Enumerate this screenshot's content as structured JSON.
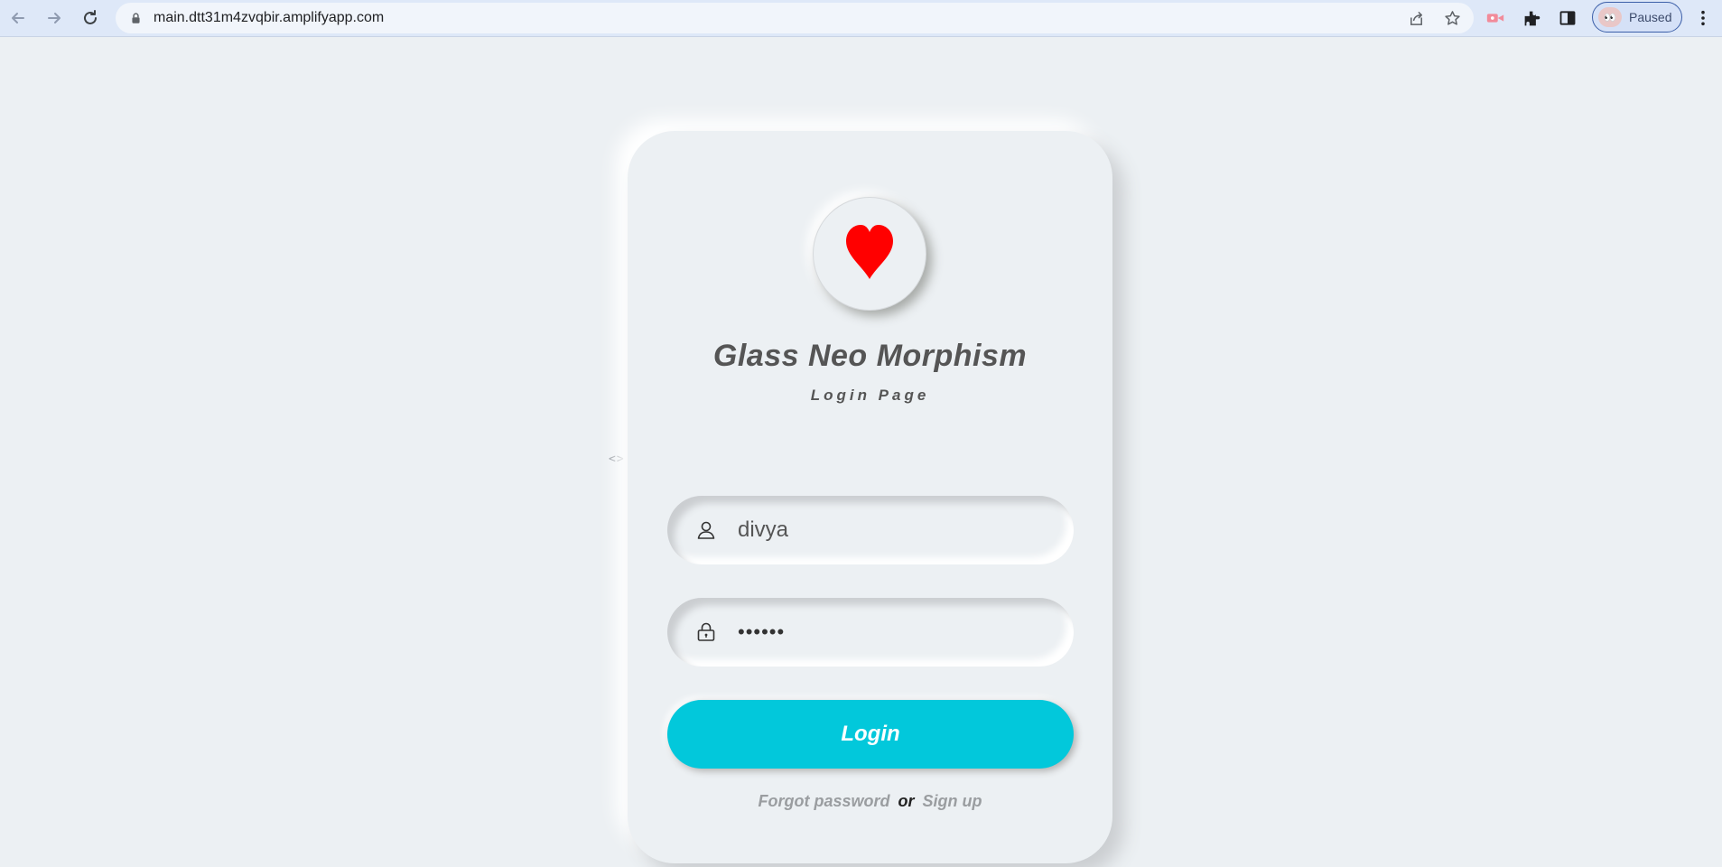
{
  "browser": {
    "url": "main.dtt31m4zvqbir.amplifyapp.com",
    "profile_status": "Paused"
  },
  "page": {
    "side_toggle": "<>",
    "logo_icon": "heart-icon",
    "title": "Glass Neo Morphism",
    "subtitle": "Login Page",
    "username": {
      "value": "divya",
      "icon": "user-icon"
    },
    "password": {
      "value": "••••••",
      "icon": "lock-icon"
    },
    "login_label": "Login",
    "forgot_label": "Forgot password",
    "or_label": "or",
    "signup_label": "Sign up",
    "colors": {
      "background": "#ecf0f3",
      "button": "#02c8db",
      "heart": "#ff0000",
      "title": "#555555"
    }
  }
}
